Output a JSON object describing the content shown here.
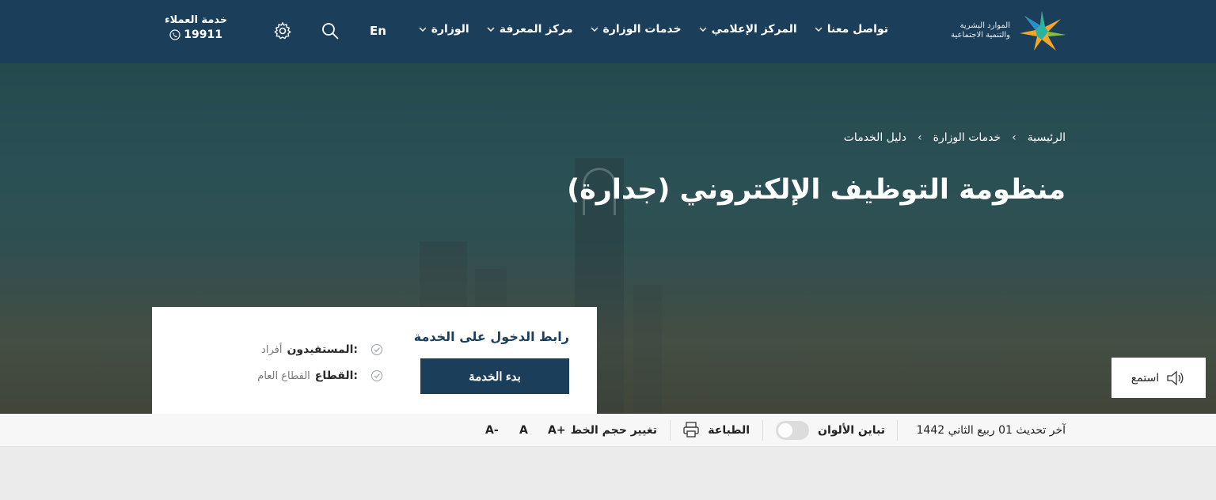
{
  "header": {
    "logo_line1": "الموارد البشرية",
    "logo_line2": "والتنمية الاجتماعية",
    "nav": [
      {
        "label": "الوزارة"
      },
      {
        "label": "مركز المعرفة"
      },
      {
        "label": "خدمات الوزارة"
      },
      {
        "label": "المركز الإعلامي"
      },
      {
        "label": "تواصل معنا"
      }
    ],
    "language": "En",
    "customer_service_label": "خدمة العملاء",
    "customer_service_number": "19911"
  },
  "hero": {
    "breadcrumb": [
      "الرئيسية",
      "خدمات الوزارة",
      "دليل الخدمات"
    ],
    "title": "منظومة التوظيف الإلكتروني (جدارة)"
  },
  "service_card": {
    "heading": "رابط الدخول على الخدمة",
    "start_button": "بدء الخدمة",
    "beneficiaries_label": "المستفيدون:",
    "beneficiaries_value": "أفراد",
    "sector_label": "القطاع:",
    "sector_value": "القطاع العام"
  },
  "listen": {
    "label": "استمع"
  },
  "toolbar": {
    "last_update": "آخر تحديث 01 ربيع الثاني 1442",
    "contrast": "تباين الألوان",
    "print": "الطباعة",
    "font_size": "تغيير حجم الخط",
    "font_increase": "A+",
    "font_normal": "A",
    "font_decrease": "A-"
  },
  "colors": {
    "primary": "#1b3f5a",
    "white": "#ffffff",
    "toolbar_bg": "#f7f7f7",
    "page_bg": "#ebebeb"
  }
}
